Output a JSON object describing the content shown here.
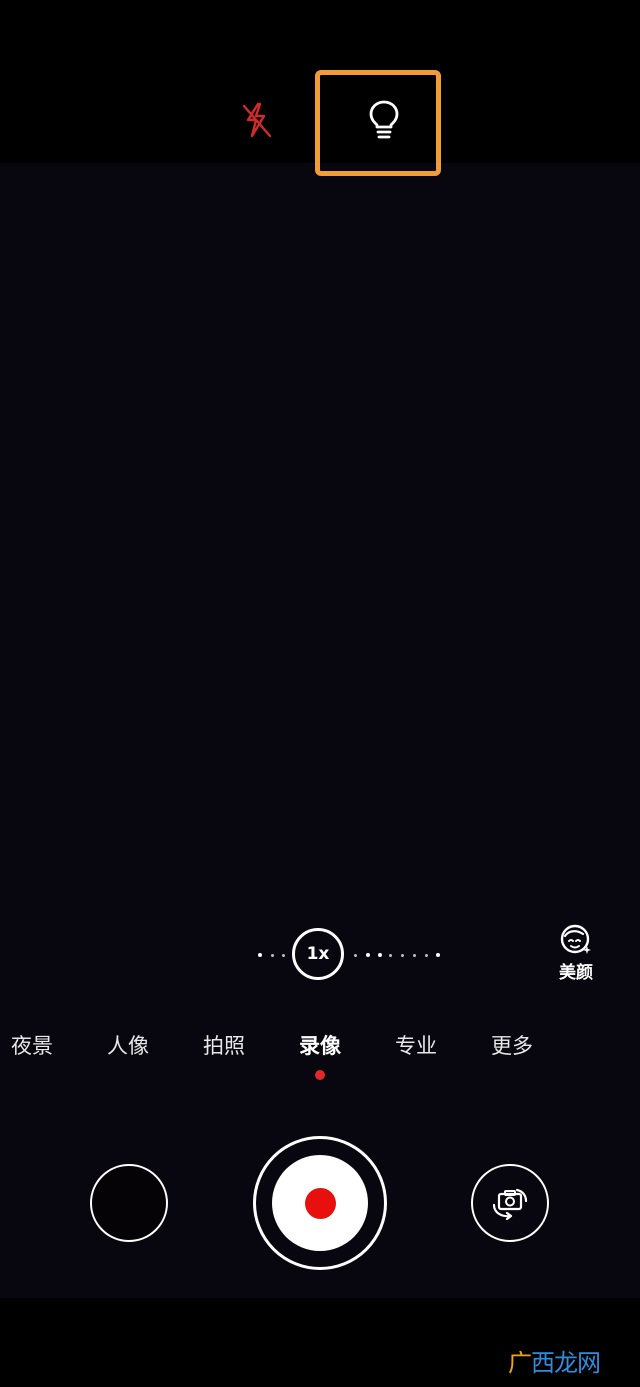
{
  "colors": {
    "highlight": "#f39a3a",
    "record": "#e8100c",
    "mode_indicator": "#e3262a",
    "flash_off": "#d02a2a"
  },
  "top_bar": {
    "flash_icon": "flash-off-icon",
    "torch_icon": "lightbulb-icon"
  },
  "zoom": {
    "label": "1x"
  },
  "beauty": {
    "icon": "face-beauty-icon",
    "label": "美颜"
  },
  "modes": {
    "items": [
      {
        "label": "夜景"
      },
      {
        "label": "人像"
      },
      {
        "label": "拍照"
      },
      {
        "label": "录像"
      },
      {
        "label": "专业"
      },
      {
        "label": "更多"
      }
    ],
    "active": "录像"
  },
  "controls": {
    "shutter": "record-button",
    "switch_icon": "switch-camera-icon"
  },
  "watermark": {
    "part1": "广",
    "part2": "西",
    "part3": "龙网"
  }
}
